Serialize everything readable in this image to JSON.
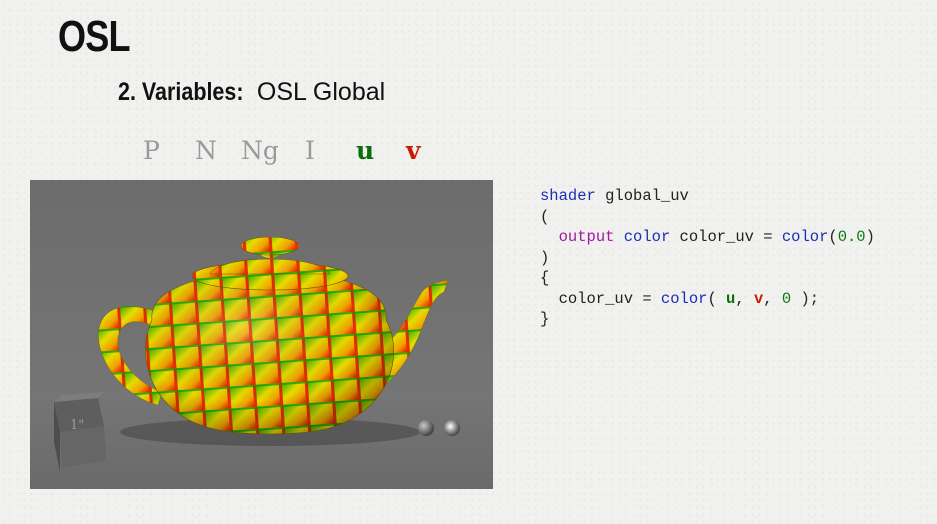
{
  "slide": {
    "title": "OSL",
    "section_number": "2. Variables:",
    "section_name": "OSL Global"
  },
  "globals": {
    "items": [
      "P",
      "N",
      "Ng",
      "I",
      "u",
      "v"
    ],
    "colors": {
      "inactive": "#9a9a9a",
      "u": "#0a6e0a",
      "v": "#cc1a00"
    }
  },
  "render": {
    "cube_label": "1\"",
    "pattern_colors": {
      "green": "#22b000",
      "yellow": "#e8e000",
      "red": "#e82000",
      "background": "#737373"
    }
  },
  "code": {
    "line1_kw": "shader",
    "line1_name": " global_uv",
    "line2": "(",
    "line3_indent": "  ",
    "line3_output": "output",
    "line3_color_kw": "color",
    "line3_var": " color_uv = ",
    "line3_color_fn": "color",
    "line3_open": "(",
    "line3_num": "0.0",
    "line3_close": ")",
    "line4": ")",
    "line5": "{",
    "line6_indent": "  color_uv = ",
    "line6_color_fn": "color",
    "line6_open": "( ",
    "line6_u": "u",
    "line6_sep1": ", ",
    "line6_v": "v",
    "line6_sep2": ", ",
    "line6_zero": "0",
    "line6_close": " );",
    "line7": "}"
  }
}
